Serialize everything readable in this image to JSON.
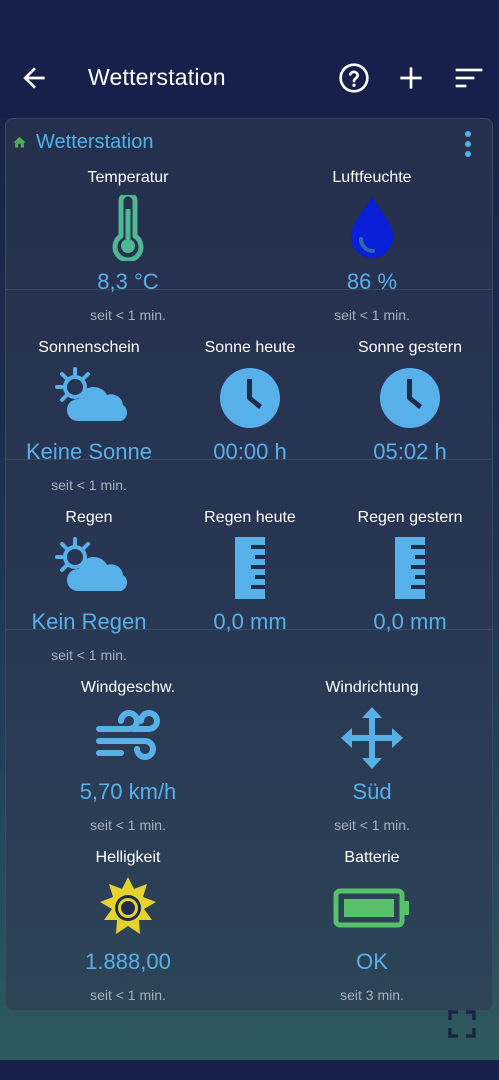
{
  "header": {
    "title": "Wetterstation",
    "icons": [
      "arrow-back-icon",
      "help-circle-icon",
      "plus-icon",
      "sort-icon"
    ]
  },
  "card": {
    "title": "Wetterstation",
    "icons": [
      "home-icon",
      "more-vert-icon"
    ]
  },
  "tiles": {
    "temperature": {
      "label": "Temperatur",
      "value": "8,3 °C",
      "since": "seit < 1 min.",
      "icon": "thermometer-icon",
      "color": "#4db892"
    },
    "humidity": {
      "label": "Luftfeuchte",
      "value": "86 %",
      "since": "seit < 1 min.",
      "icon": "water-drop-icon",
      "color": "#0a1fd8"
    },
    "sunshine": {
      "label": "Sonnenschein",
      "value": "Keine Sonne",
      "since": "seit < 1 min.",
      "icon": "partly-cloudy-icon",
      "color": "#58b0e8"
    },
    "sun_today": {
      "label": "Sonne heute",
      "value": "00:00 h",
      "icon": "clock-icon",
      "color": "#58b0e8"
    },
    "sun_yesterday": {
      "label": "Sonne gestern",
      "value": "05:02 h",
      "icon": "clock-icon",
      "color": "#58b0e8"
    },
    "rain": {
      "label": "Regen",
      "value": "Kein Regen",
      "since": "seit < 1 min.",
      "icon": "partly-cloudy-icon",
      "color": "#58b0e8"
    },
    "rain_today": {
      "label": "Regen heute",
      "value": "0,0 mm",
      "icon": "ruler-icon",
      "color": "#58b0e8"
    },
    "rain_yesterday": {
      "label": "Regen gestern",
      "value": "0,0 mm",
      "icon": "ruler-icon",
      "color": "#58b0e8"
    },
    "wind_speed": {
      "label": "Windgeschw.",
      "value": "5,70 km/h",
      "since": "seit < 1 min.",
      "icon": "wind-icon",
      "color": "#58b0e8"
    },
    "wind_direction": {
      "label": "Windrichtung",
      "value": "Süd",
      "since": "seit < 1 min.",
      "icon": "move-arrows-icon",
      "color": "#58b0e8"
    },
    "brightness": {
      "label": "Helligkeit",
      "value": "1.888,00",
      "since": "seit < 1 min.",
      "icon": "sun-icon",
      "color": "#e6d22e"
    },
    "battery": {
      "label": "Batterie",
      "value": "OK",
      "since": "seit 3 min.",
      "icon": "battery-full-icon",
      "color": "#57c26b"
    }
  },
  "footer": {
    "icon": "fullscreen-icon"
  },
  "colors": {
    "accent": "#4fb3e8",
    "value": "#58b0e8",
    "background": "#16204a",
    "home": "#4caf50"
  }
}
